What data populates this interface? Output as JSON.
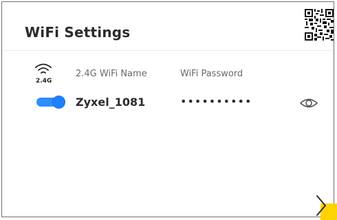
{
  "panel": {
    "title": "WiFi Settings"
  },
  "table": {
    "band": "2.4G",
    "name_header": "2.4G WiFi Name",
    "password_header": "WiFi Password",
    "ssid": "Zyxel_1081",
    "password_masked": "••••••••••",
    "enabled": true
  },
  "icons": {
    "wifi": "wifi-signal-icon",
    "visibility": "eye-icon",
    "next": "chevron-right-icon",
    "qr": "qr-code-icon"
  },
  "colors": {
    "toggle_on": "#1e80ff",
    "accent": "#ffd200"
  }
}
